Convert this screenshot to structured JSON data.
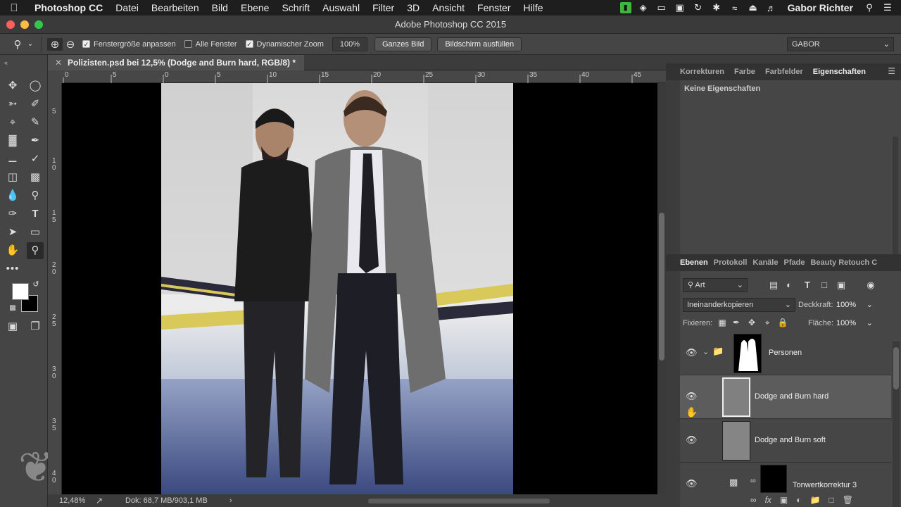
{
  "menubar": {
    "app": "Photoshop CC",
    "items": [
      "Datei",
      "Bearbeiten",
      "Bild",
      "Ebene",
      "Schrift",
      "Auswahl",
      "Filter",
      "3D",
      "Ansicht",
      "Fenster",
      "Hilfe"
    ],
    "user": "Gabor Richter"
  },
  "window": {
    "title": "Adobe Photoshop CC 2015"
  },
  "options": {
    "resize_windows": "Fenstergröße anpassen",
    "all_windows": "Alle Fenster",
    "scrubby_zoom": "Dynamischer Zoom",
    "zoom_value": "100%",
    "fit_screen": "Ganzes Bild",
    "fill_screen": "Bildschirm ausfüllen",
    "workspace": "GABOR"
  },
  "document": {
    "tab_title": "Polizisten.psd bei 12,5% (Dodge and Burn hard, RGB/8) *",
    "ruler_top": [
      "0",
      "5",
      "0",
      "5",
      "10",
      "15",
      "20",
      "25",
      "30",
      "35",
      "40",
      "45"
    ],
    "ruler_left": [
      "5",
      "1\n0",
      "1\n5",
      "2\n0",
      "2\n5",
      "3\n0",
      "3\n5",
      "4\n0"
    ],
    "status_zoom": "12,48%",
    "status_doc": "Dok: 68,7 MB/903,1 MB"
  },
  "properties_panel": {
    "tabs": [
      "Korrekturen",
      "Farbe",
      "Farbfelder",
      "Eigenschaften"
    ],
    "active_tab": "Eigenschaften",
    "empty_text": "Keine Eigenschaften"
  },
  "layers_panel": {
    "tabs": [
      "Ebenen",
      "Protokoll",
      "Kanäle",
      "Pfade",
      "Beauty Retouch C"
    ],
    "active_tab": "Ebenen",
    "filter": "Art",
    "blend_mode": "Ineinanderkopieren",
    "opacity_label": "Deckkraft:",
    "opacity": "100%",
    "lock_label": "Fixieren:",
    "fill_label": "Fläche:",
    "fill": "100%",
    "layers": [
      {
        "name": "Personen",
        "type": "group"
      },
      {
        "name": "Dodge and Burn hard",
        "type": "pixel",
        "selected": true
      },
      {
        "name": "Dodge and Burn soft",
        "type": "pixel"
      },
      {
        "name": "Tonwertkorrektur 3",
        "type": "adjustment"
      }
    ]
  }
}
